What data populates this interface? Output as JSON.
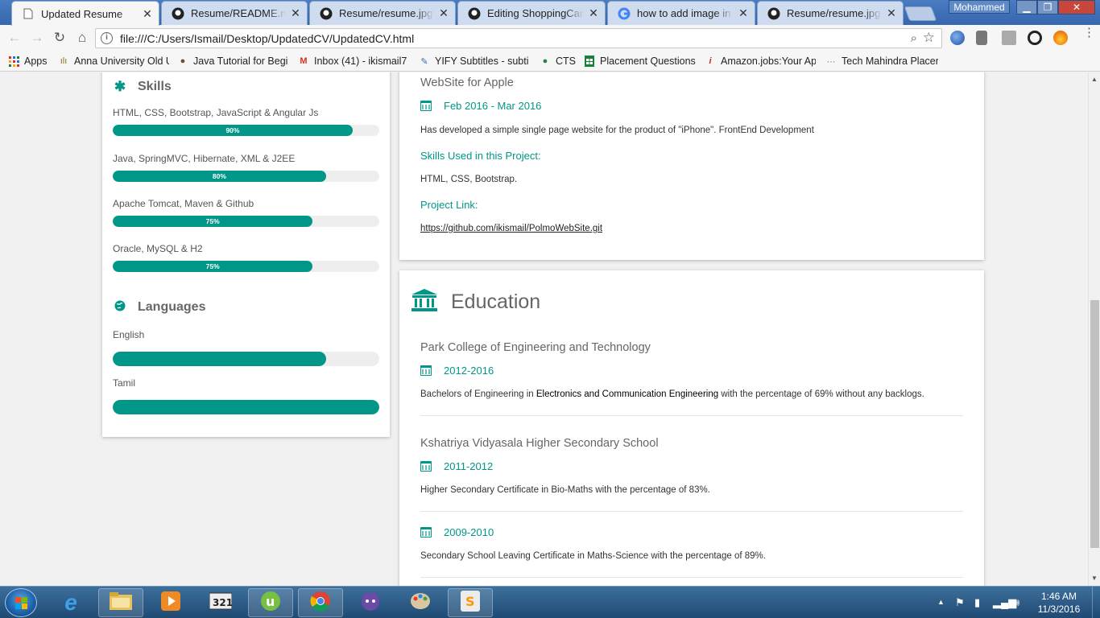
{
  "browser": {
    "tabs": [
      {
        "title": "Updated Resume",
        "icon": "page-icon",
        "active": true
      },
      {
        "title": "Resume/README.md at",
        "icon": "github-icon",
        "active": false
      },
      {
        "title": "Resume/resume.jpg at",
        "icon": "github-icon",
        "active": false
      },
      {
        "title": "Editing ShoppingCart/R",
        "icon": "github-icon",
        "active": false
      },
      {
        "title": "how to add image in re",
        "icon": "google-icon",
        "active": false
      },
      {
        "title": "Resume/resume.jpg at",
        "icon": "github-icon",
        "active": false
      }
    ],
    "user": "Mohammed",
    "url": "file:///C:/Users/Ismail/Desktop/UpdatedCV/UpdatedCV.html",
    "bookmarks": [
      {
        "label": "Apps",
        "icon": "apps-grid-icon"
      },
      {
        "label": "Anna University Old U",
        "icon": "anna-university-icon"
      },
      {
        "label": "Java Tutorial for Begin",
        "icon": "java-tutorial-icon"
      },
      {
        "label": "Inbox (41) - ikismail7",
        "icon": "gmail-icon"
      },
      {
        "label": "YIFY Subtitles - subti",
        "icon": "yify-icon"
      },
      {
        "label": "CTS",
        "icon": "globe-icon"
      },
      {
        "label": "Placement Questions",
        "icon": "sheets-icon"
      },
      {
        "label": "Amazon.jobs:Your Ap",
        "icon": "amazon-jobs-icon"
      },
      {
        "label": "Tech Mahindra Placen",
        "icon": "tech-mahindra-icon"
      }
    ]
  },
  "skills": {
    "title": "Skills",
    "items": [
      {
        "label": "HTML, CSS, Bootstrap, JavaScript & Angular Js",
        "percent": 90,
        "percent_text": "90%"
      },
      {
        "label": "Java, SpringMVC, Hibernate, XML & J2EE",
        "percent": 80,
        "percent_text": "80%"
      },
      {
        "label": "Apache Tomcat, Maven & Github",
        "percent": 75,
        "percent_text": "75%"
      },
      {
        "label": "Oracle, MySQL & H2",
        "percent": 75,
        "percent_text": "75%"
      }
    ]
  },
  "languages": {
    "title": "Languages",
    "items": [
      {
        "label": "English",
        "percent": 80
      },
      {
        "label": "Tamil",
        "percent": 100
      }
    ]
  },
  "project": {
    "title": "WebSite for Apple",
    "date": "Feb 2016 - Mar 2016",
    "description": "Has developed a simple single page website for the product of \"iPhone\". FrontEnd Development",
    "skills_heading": "Skills Used in this Project:",
    "skills": "HTML, CSS, Bootstrap.",
    "link_heading": "Project Link:",
    "link": "https://github.com/ikismail/PolmoWebSite.git"
  },
  "education": {
    "title": "Education",
    "items": [
      {
        "school": "Park College of Engineering and Technology",
        "years": "2012-2016",
        "desc_pre": "Bachelors of Engineering in ",
        "desc_bold": "Electronics and Communication Engineering",
        "desc_post": " with the percentage of 69% without any backlogs."
      },
      {
        "school": "Kshatriya Vidyasala Higher Secondary School",
        "years": "2011-2012",
        "desc": "Higher Secondary Certificate in Bio-Maths with the percentage of 83%."
      },
      {
        "years": "2009-2010",
        "desc": "Secondary School Leaving Certificate in Maths-Science with the percentage of 89%."
      }
    ]
  },
  "taskbar": {
    "time": "1:46 AM",
    "date": "11/3/2016"
  },
  "colors": {
    "accent": "#009688",
    "titlebar": "#3d70b7",
    "taskbar": "#1f4a73"
  }
}
